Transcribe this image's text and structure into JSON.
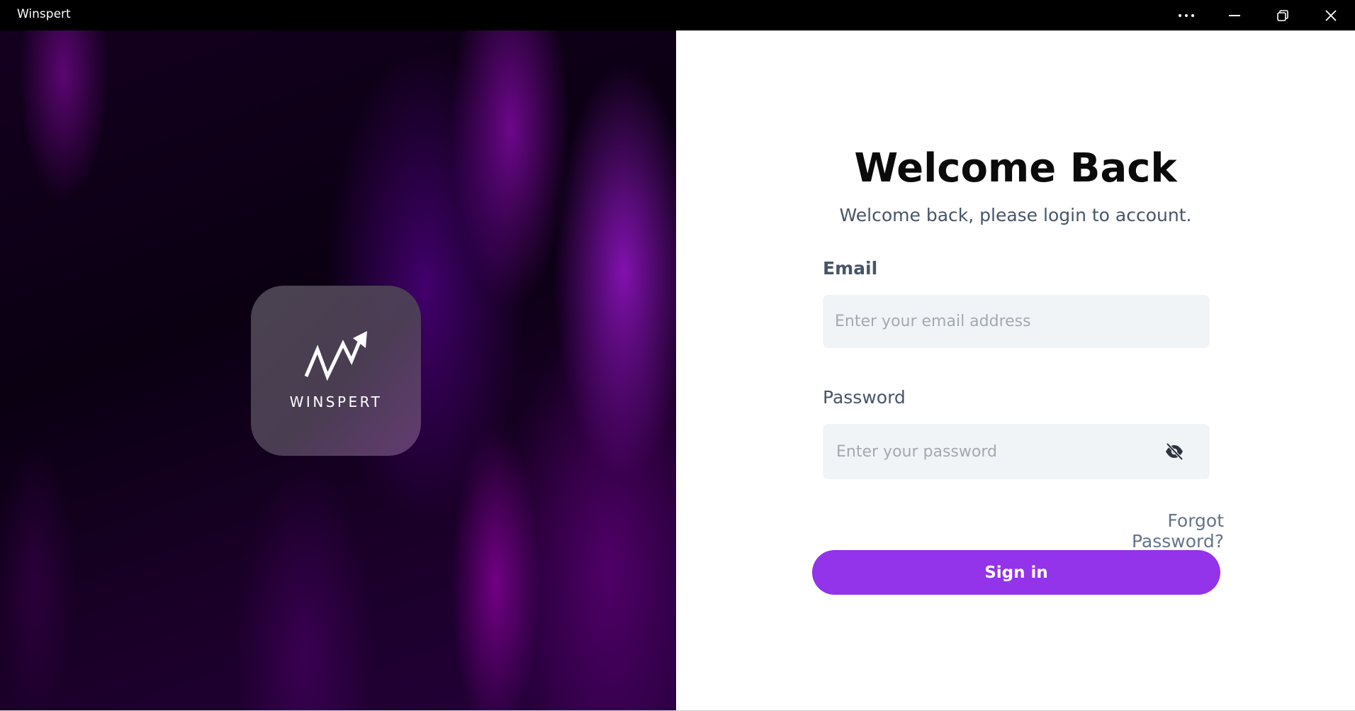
{
  "window": {
    "title": "Winspert",
    "controls": {
      "more_icon": "more-horizontal-icon",
      "minimize_icon": "minimize-icon",
      "restore_icon": "restore-icon",
      "close_icon": "close-icon"
    }
  },
  "brand": {
    "name": "WINSPERT",
    "logo_icon": "trend-arrow-icon"
  },
  "login": {
    "heading": "Welcome Back",
    "subheading": "Welcome back, please login to account.",
    "email": {
      "label": "Email",
      "value": "",
      "placeholder": "Enter your email address"
    },
    "password": {
      "label": "Password",
      "value": "",
      "placeholder": "Enter your password",
      "toggle_icon": "eye-slash-icon"
    },
    "forgot_label": "Forgot Password?",
    "signin_label": "Sign in"
  },
  "colors": {
    "accent": "#9333ea",
    "titlebar": "#000000",
    "input_bg": "#f1f4f7",
    "label_text": "#475569",
    "placeholder_text": "#a3a9b1"
  }
}
